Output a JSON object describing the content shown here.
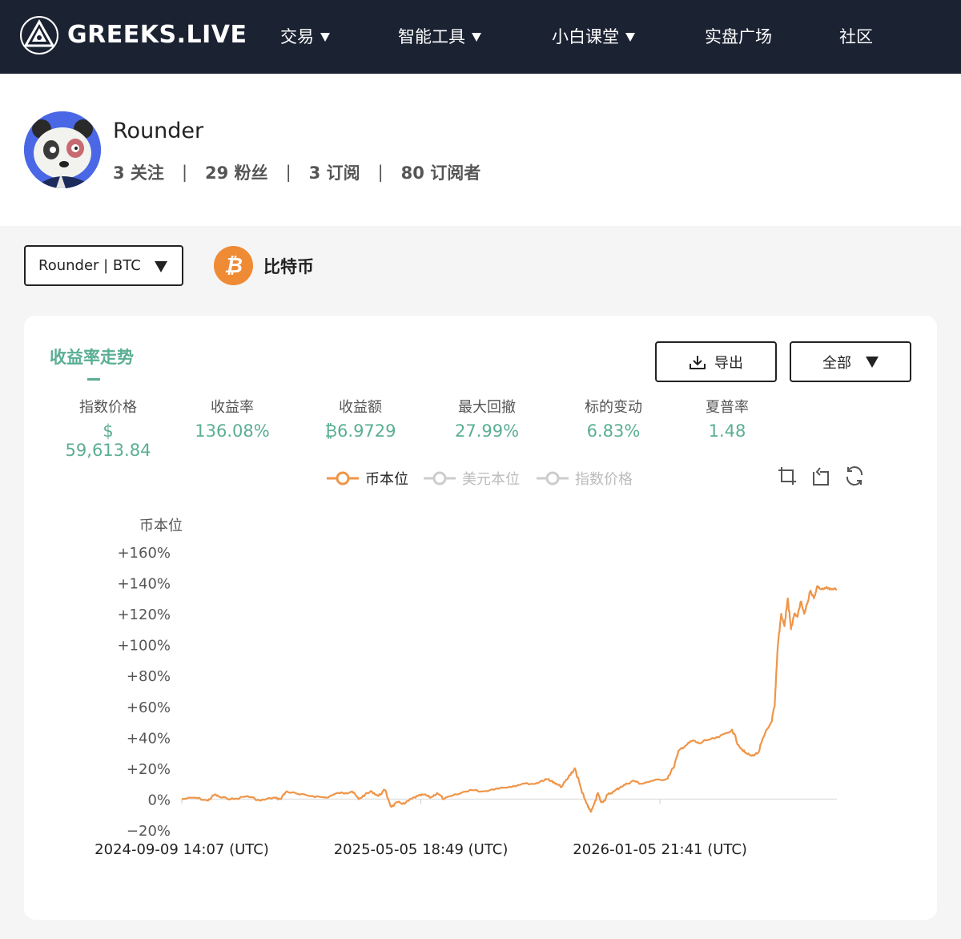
{
  "brand": {
    "name": "GREEKS.LIVE",
    "logo_icon": "greeks-triangle-logo"
  },
  "nav": {
    "items": [
      {
        "label": "交易",
        "dropdown": true
      },
      {
        "label": "智能工具",
        "dropdown": true
      },
      {
        "label": "小白课堂",
        "dropdown": true
      },
      {
        "label": "实盘广场",
        "dropdown": false
      },
      {
        "label": "社区",
        "dropdown": false
      }
    ]
  },
  "profile": {
    "username": "Rounder",
    "following": "3 关注",
    "followers": "29 粉丝",
    "subscriptions": "3 订阅",
    "subscribers": "80 订阅者",
    "separator": "|",
    "avatar_icon": "panda-avatar"
  },
  "selector": {
    "value": "Rounder | BTC"
  },
  "coin": {
    "symbol": "₿",
    "name": "比特币",
    "color": "#ef8b35"
  },
  "card": {
    "title": "收益率走势",
    "export_label": "导出",
    "range_label": "全部",
    "metrics": [
      {
        "label": "指数价格",
        "value": "$ 59,613.84"
      },
      {
        "label": "收益率",
        "value": "136.08%"
      },
      {
        "label": "收益额",
        "value": "₿6.9729"
      },
      {
        "label": "最大回撤",
        "value": "27.99%"
      },
      {
        "label": "标的变动",
        "value": "6.83%"
      },
      {
        "label": "夏普率",
        "value": "1.48"
      }
    ],
    "legend": [
      {
        "label": "币本位",
        "active": true
      },
      {
        "label": "美元本位",
        "active": false
      },
      {
        "label": "指数价格",
        "active": false
      }
    ],
    "tools": [
      "zoom-icon",
      "zoom-reset-icon",
      "refresh-icon"
    ]
  },
  "colors": {
    "accent": "#5aae94",
    "series": "#ef9548",
    "nav_bg": "#1b2232"
  },
  "chart_data": {
    "type": "line",
    "ylabel": "币本位",
    "ylim": [
      -20,
      160
    ],
    "yticks": [
      "+160%",
      "+140%",
      "+120%",
      "+100%",
      "+80%",
      "+60%",
      "+40%",
      "+20%",
      "0%",
      "−20%"
    ],
    "ytick_values": [
      160,
      140,
      120,
      100,
      80,
      60,
      40,
      20,
      0,
      -20
    ],
    "xtick_labels": [
      "2024-09-09 14:07 (UTC)",
      "2025-05-05 18:49 (UTC)",
      "2026-01-05 21:41 (UTC)"
    ],
    "xtick_positions": [
      0,
      0.365,
      0.73
    ],
    "series": [
      {
        "name": "币本位",
        "x": [
          0,
          0.02,
          0.04,
          0.05,
          0.06,
          0.08,
          0.1,
          0.12,
          0.14,
          0.15,
          0.16,
          0.18,
          0.2,
          0.22,
          0.24,
          0.25,
          0.26,
          0.27,
          0.28,
          0.29,
          0.3,
          0.31,
          0.32,
          0.33,
          0.34,
          0.35,
          0.36,
          0.37,
          0.38,
          0.39,
          0.4,
          0.42,
          0.44,
          0.46,
          0.48,
          0.5,
          0.52,
          0.54,
          0.55,
          0.56,
          0.57,
          0.58,
          0.59,
          0.6,
          0.61,
          0.615,
          0.62,
          0.625,
          0.63,
          0.635,
          0.64,
          0.645,
          0.65,
          0.66,
          0.67,
          0.68,
          0.69,
          0.7,
          0.72,
          0.74,
          0.75,
          0.76,
          0.77,
          0.78,
          0.79,
          0.8,
          0.82,
          0.84,
          0.85,
          0.86,
          0.87,
          0.88,
          0.89,
          0.9,
          0.905,
          0.91,
          0.915,
          0.92,
          0.925,
          0.93,
          0.935,
          0.94,
          0.945,
          0.95,
          0.96,
          0.965,
          0.97,
          0.975,
          0.98,
          0.985,
          0.99,
          0.995,
          1.0
        ],
        "y": [
          0,
          1,
          -1,
          3,
          1,
          0,
          2,
          -1,
          1,
          0,
          5,
          3,
          2,
          1,
          4,
          4,
          5,
          0,
          3,
          5,
          2,
          6,
          -5,
          -2,
          -3,
          0,
          2,
          3,
          1,
          4,
          0,
          3,
          6,
          5,
          7,
          8,
          10,
          10,
          12,
          13,
          10,
          8,
          14,
          20,
          6,
          0,
          -5,
          -8,
          -3,
          4,
          -2,
          -1,
          3,
          5,
          8,
          10,
          12,
          10,
          12,
          13,
          20,
          32,
          35,
          38,
          36,
          38,
          40,
          45,
          35,
          30,
          28,
          30,
          42,
          50,
          60,
          100,
          120,
          112,
          130,
          110,
          120,
          118,
          128,
          120,
          135,
          130,
          138,
          136,
          136,
          137,
          136,
          136,
          136
        ]
      }
    ]
  }
}
